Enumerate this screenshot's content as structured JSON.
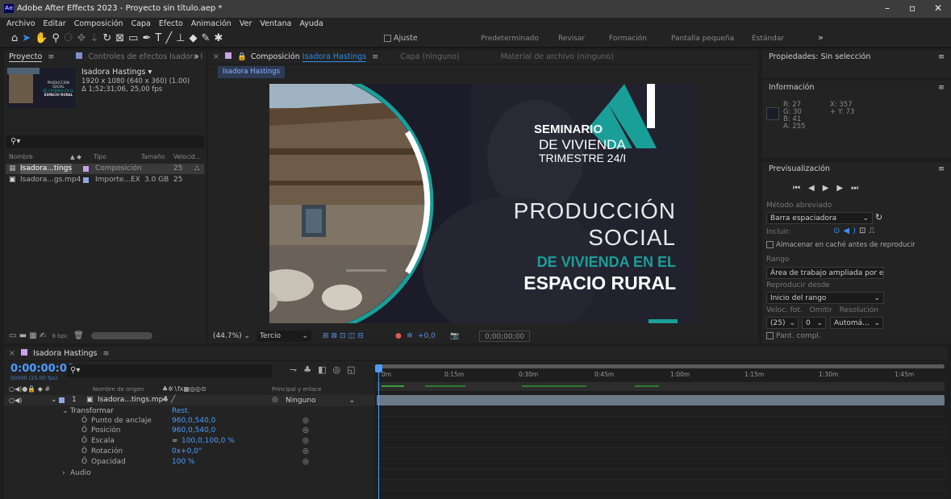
{
  "window": {
    "title": "Adobe After Effects 2023 - Proyecto sin título.aep *",
    "app_icon": "Ae"
  },
  "menu": [
    "Archivo",
    "Editar",
    "Composición",
    "Capa",
    "Efecto",
    "Animación",
    "Ver",
    "Ventana",
    "Ayuda"
  ],
  "toolbar": {
    "snap_label": "Ajuste",
    "workspaces": [
      "Predeterminado",
      "Revisar",
      "Formación",
      "Pantalla pequeña",
      "Estándar"
    ],
    "more": "»"
  },
  "project": {
    "tab": "Proyecto",
    "effects_tab": "Controles de efectos Isadora I",
    "overflow": "»",
    "comp_name": "Isadora Hastings ▾",
    "comp_size": "1920 x 1080  (640 x 360) (1.00)",
    "comp_duration": "Δ 1;52;31;06, 25,00 fps",
    "thumb_lines": [
      "PRODUCCIÓN",
      "SOCIAL",
      "DE VIVIENDA EN EL",
      "ESPACIO RURAL"
    ],
    "search_icon": "search-icon",
    "columns": [
      "Nombre",
      "Tipo",
      "Tamaño",
      "Velocid..."
    ],
    "items": [
      {
        "name": "Isadora...tings",
        "type": "Composición",
        "size": "",
        "rate": "25"
      },
      {
        "name": "Isadora...gs.mp4",
        "type": "Importe...EX",
        "size": "3.0 GB",
        "rate": "25"
      }
    ],
    "bpc": "8 bpc"
  },
  "composition": {
    "tab_prefix": "Composición",
    "tab_name": "Isadora Hastings",
    "layer_tab": "Capa (ninguno)",
    "footage_tab": "Material de archivo (ninguno)",
    "breadcrumb": "Isadora Hastings",
    "zoom": "(44.7%)",
    "grid": "Tercio",
    "exposure": "+0,0",
    "timecode": "0;00;00;00"
  },
  "frame": {
    "line1": "SEMINARIO",
    "line2": "DE VIVIENDA",
    "line3": "TRIMESTRE 24/I",
    "big1": "PRODUCCIÓN",
    "big2": "SOCIAL",
    "teal": "DE VIVIENDA EN EL",
    "white": "ESPACIO RURAL",
    "colors": {
      "navy": "#1b1b29",
      "teal": "#1a9e98",
      "sky": "#9fb3c2"
    }
  },
  "properties": {
    "title": "Propiedades: Sin selección"
  },
  "info": {
    "title": "Información",
    "r": "R: 27",
    "g": "G: 30",
    "b": "B: 41",
    "a": "A: 255",
    "x": "X: 357",
    "y": "+ Y: 73",
    "swatch": "#1b1b29"
  },
  "preview": {
    "title": "Previsualización",
    "shortcut_label": "Método abreviado",
    "shortcut": "Barra espaciadora",
    "include": "Incluir:",
    "cache": "Almacenar en caché antes de reproducir",
    "range_label": "Rango",
    "range": "Área de trabajo ampliada por el ...",
    "play_from_label": "Reproducir desde",
    "play_from": "Inicio del rango",
    "fps_label": "Veloc. fot.",
    "skip_label": "Omitir",
    "res_label": "Resolución",
    "fps": "(25)",
    "skip": "0",
    "res": "Automá...",
    "fullscreen": "Pant. compl."
  },
  "timeline": {
    "tab": "Isadora Hastings",
    "timecode": "0:00:00:00",
    "fps_sub": "00000 (25.00 fps)",
    "col_name": "Nombre de origen",
    "col_parent": "Principal y enlace",
    "layer": {
      "index": "1",
      "name": "Isadora...tings.mp4",
      "parent": "Ninguno"
    },
    "transform": "Transformar",
    "reset": "Rest.",
    "props": [
      {
        "name": "Punto de anclaje",
        "value": "960,0,540,0"
      },
      {
        "name": "Posición",
        "value": "960,0,540,0"
      },
      {
        "name": "Escala",
        "value": "100,0,100,0 %"
      },
      {
        "name": "Rotación",
        "value": "0x+0,0°"
      },
      {
        "name": "Opacidad",
        "value": "100 %"
      }
    ],
    "audio": "Audio",
    "ruler": [
      "0m",
      "0:15m",
      "0:30m",
      "0:45m",
      "1:00m",
      "1:15m",
      "1:30m",
      "1:45m"
    ]
  }
}
